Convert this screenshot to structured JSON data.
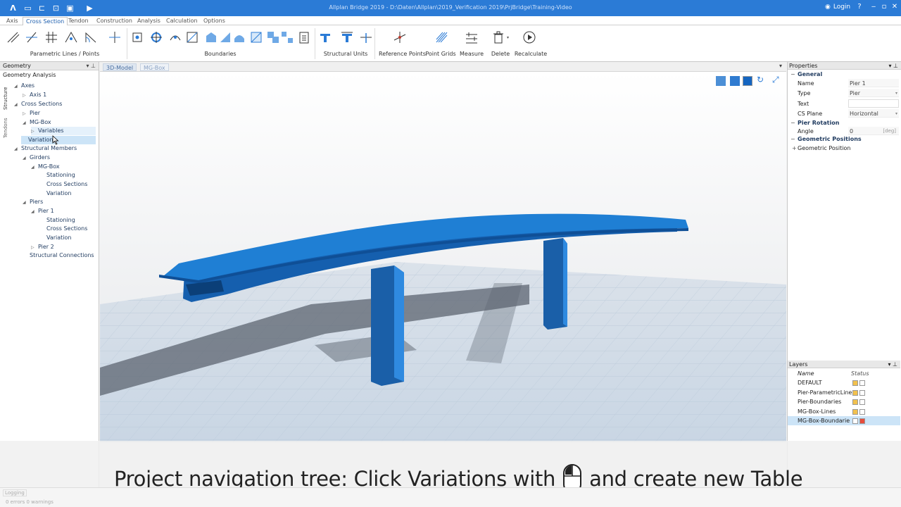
{
  "window": {
    "title": "Allplan Bridge 2019 - D:\\Daten\\Allplan\\2019_Verification 2019\\PrjBridge\\Training-Video",
    "login_label": "Login"
  },
  "menu": {
    "tabs": [
      "Axis",
      "Cross Section",
      "Tendon",
      "Construction",
      "Analysis",
      "Calculation",
      "Options"
    ],
    "active": "Cross Section"
  },
  "ribbon": {
    "groups": {
      "parametric": "Parametric Lines / Points",
      "boundaries": "Boundaries",
      "structural_units": "Structural Units",
      "reference_points": "Reference Points",
      "point_grids": "Point Grids",
      "measure": "Measure",
      "delete": "Delete",
      "recalculate": "Recalculate"
    }
  },
  "left_panel": {
    "title": "Geometry",
    "subtitle": "Geometry Analysis",
    "vertical_tabs": [
      "Structure",
      "Tendons"
    ],
    "tree": [
      {
        "label": "Axes"
      },
      {
        "label": "Axis 1"
      },
      {
        "label": "Cross Sections"
      },
      {
        "label": "Pier"
      },
      {
        "label": "MG-Box"
      },
      {
        "label": "Variables"
      },
      {
        "label": "Variations"
      },
      {
        "label": "Structural Members"
      },
      {
        "label": "Girders"
      },
      {
        "label": "MG-Box"
      },
      {
        "label": "Stationing"
      },
      {
        "label": "Cross Sections"
      },
      {
        "label": "Variation"
      },
      {
        "label": "Piers"
      },
      {
        "label": "Pier 1"
      },
      {
        "label": "Stationing"
      },
      {
        "label": "Cross Sections"
      },
      {
        "label": "Variation"
      },
      {
        "label": "Pier 2"
      },
      {
        "label": "Structural Connections"
      }
    ]
  },
  "viewport": {
    "tabs": [
      "3D-Model",
      "MG-Box"
    ]
  },
  "properties": {
    "title": "Properties",
    "general_label": "General",
    "name_label": "Name",
    "name_value": "Pier 1",
    "type_label": "Type",
    "type_value": "Pier",
    "text_label": "Text",
    "text_value": "",
    "csplane_label": "CS Plane",
    "csplane_value": "Horizontal",
    "rotation_label": "Pier Rotation",
    "angle_label": "Angle",
    "angle_value": "0",
    "angle_unit": "[deg]",
    "geo_positions_label": "Geometric Positions",
    "geo_position_label": "Geometric Position"
  },
  "layers": {
    "title": "Layers",
    "col_name": "Name",
    "col_status": "Status",
    "rows": [
      {
        "name": "DEFAULT"
      },
      {
        "name": "Pier-ParametricLine"
      },
      {
        "name": "Pier-Boundaries"
      },
      {
        "name": "MG-Box-Lines"
      },
      {
        "name": "MG-Box-Boundarie"
      }
    ]
  },
  "status": {
    "log_tab": "Logging",
    "counts": "0 errors 0 warnings"
  },
  "caption": {
    "before": "Project navigation tree: Click Variations with",
    "after": "and create new Table"
  },
  "colors": {
    "titlebar": "#2b7bd6",
    "bridge": "#1f7fd4",
    "selection": "#cce4f7"
  }
}
